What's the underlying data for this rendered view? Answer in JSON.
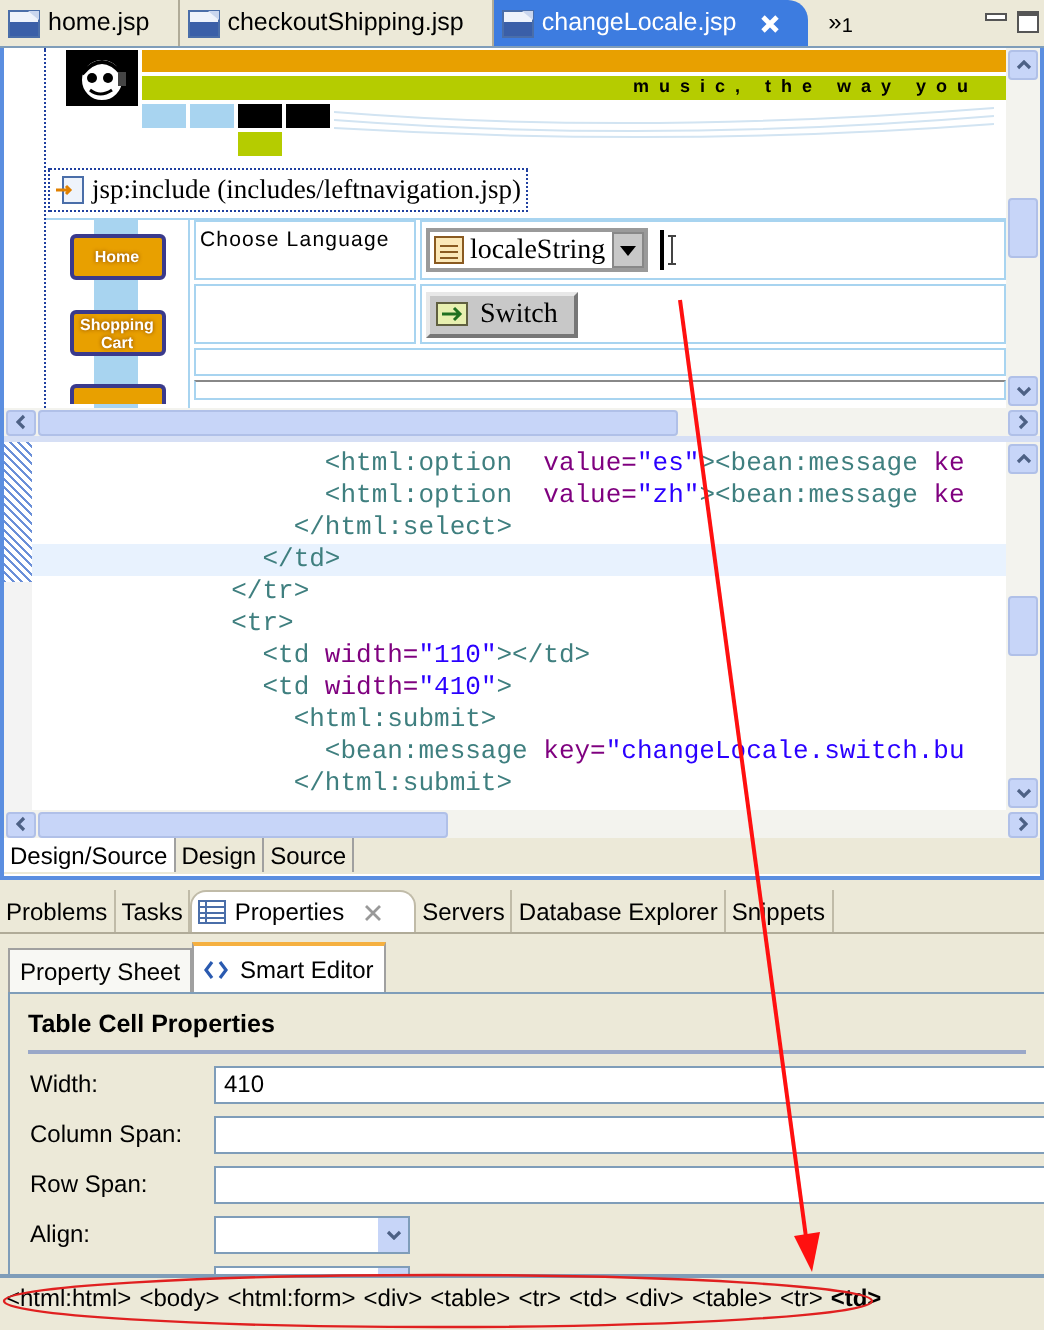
{
  "editor_tabs": [
    {
      "label": "home.jsp",
      "selected": false
    },
    {
      "label": "checkoutShipping.jsp",
      "selected": false
    },
    {
      "label": "changeLocale.jsp",
      "selected": true
    }
  ],
  "tab_overflow": {
    "arrows": "»",
    "count": "1"
  },
  "design": {
    "tagline": "music, the way you",
    "include_label": "jsp:include (includes/leftnavigation.jsp)",
    "nav_buttons": [
      "Home",
      "Shopping Cart"
    ],
    "choose_label": "Choose Language",
    "select_value": "localeString",
    "switch_button": "Switch"
  },
  "source": {
    "lines": [
      {
        "selected": false,
        "tokens": [
          {
            "kind": "tag",
            "text": "                  <html:option"
          },
          {
            "kind": "attr",
            "text": "  value="
          },
          {
            "kind": "value",
            "text": "\"es\""
          },
          {
            "kind": "tag",
            "text": "><bean:message"
          },
          {
            "kind": "attr",
            "text": " ke"
          }
        ]
      },
      {
        "selected": false,
        "tokens": [
          {
            "kind": "tag",
            "text": "                  <html:option"
          },
          {
            "kind": "attr",
            "text": "  value="
          },
          {
            "kind": "value",
            "text": "\"zh\""
          },
          {
            "kind": "tag",
            "text": "><bean:message"
          },
          {
            "kind": "attr",
            "text": " ke"
          }
        ]
      },
      {
        "selected": false,
        "tokens": [
          {
            "kind": "tag",
            "text": "                </html:select>"
          }
        ]
      },
      {
        "selected": true,
        "tokens": [
          {
            "kind": "tag",
            "text": "              </td>"
          }
        ]
      },
      {
        "selected": false,
        "tokens": [
          {
            "kind": "tag",
            "text": "            </tr>"
          }
        ]
      },
      {
        "selected": false,
        "tokens": [
          {
            "kind": "tag",
            "text": "            <tr>"
          }
        ]
      },
      {
        "selected": false,
        "tokens": [
          {
            "kind": "tag",
            "text": "              <td"
          },
          {
            "kind": "attr",
            "text": " width="
          },
          {
            "kind": "value",
            "text": "\"110\""
          },
          {
            "kind": "tag",
            "text": "></td>"
          }
        ]
      },
      {
        "selected": false,
        "tokens": [
          {
            "kind": "tag",
            "text": "              <td"
          },
          {
            "kind": "attr",
            "text": " width="
          },
          {
            "kind": "value",
            "text": "\"410\""
          },
          {
            "kind": "tag",
            "text": ">"
          }
        ]
      },
      {
        "selected": false,
        "tokens": [
          {
            "kind": "tag",
            "text": "                <html:submit>"
          }
        ]
      },
      {
        "selected": false,
        "tokens": [
          {
            "kind": "tag",
            "text": "                  <bean:message"
          },
          {
            "kind": "attr",
            "text": " key="
          },
          {
            "kind": "value",
            "text": "\"changeLocale.switch.bu"
          }
        ]
      },
      {
        "selected": false,
        "tokens": [
          {
            "kind": "tag",
            "text": "                </html:submit>"
          }
        ]
      }
    ]
  },
  "mode_tabs": [
    {
      "label": "Design/Source",
      "selected": true
    },
    {
      "label": "Design",
      "selected": false
    },
    {
      "label": "Source",
      "selected": false
    }
  ],
  "view_tabs": [
    {
      "label": "Problems",
      "selected": false
    },
    {
      "label": "Tasks",
      "selected": false
    },
    {
      "label": "Properties",
      "selected": true
    },
    {
      "label": "Servers",
      "selected": false
    },
    {
      "label": "Database Explorer",
      "selected": false
    },
    {
      "label": "Snippets",
      "selected": false
    }
  ],
  "sub_tabs": [
    {
      "label": "Property Sheet",
      "selected": false
    },
    {
      "label": "Smart Editor",
      "selected": true
    }
  ],
  "properties": {
    "title": "Table Cell Properties",
    "fields": [
      {
        "kind": "text",
        "label": "Width:",
        "value": "410"
      },
      {
        "kind": "text",
        "label": "Column Span:"
      },
      {
        "kind": "text",
        "label": "Row Span:"
      },
      {
        "kind": "select",
        "label": "Align:"
      },
      {
        "kind": "select"
      }
    ]
  },
  "breadcrumb": [
    {
      "label": "<html:html>",
      "selected": false
    },
    {
      "label": "<body>",
      "selected": false
    },
    {
      "label": "<html:form>",
      "selected": false
    },
    {
      "label": "<div>",
      "selected": false
    },
    {
      "label": "<table>",
      "selected": false
    },
    {
      "label": "<tr>",
      "selected": false
    },
    {
      "label": "<td>",
      "selected": false
    },
    {
      "label": "<div>",
      "selected": false
    },
    {
      "label": "<table>",
      "selected": false
    },
    {
      "label": "<tr>",
      "selected": false
    },
    {
      "label": "<td>",
      "selected": true
    }
  ]
}
